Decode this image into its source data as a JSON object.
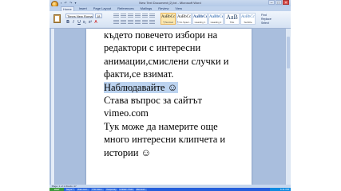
{
  "window": {
    "title": "New Text Document (2).txt - Microsoft Word",
    "quick_access": "▪ ↶ ↷ ▾",
    "controls": {
      "minimize": "–",
      "maximize": "□",
      "close": "×"
    }
  },
  "ribbon": {
    "tabs": [
      "Home",
      "Insert",
      "Page Layout",
      "References",
      "Mailings",
      "Review",
      "View"
    ],
    "active_tab": "Home",
    "font_name": "Times New Roman",
    "font_size": "18",
    "format_buttons": [
      "B",
      "I",
      "U",
      "x₂",
      "x²",
      "A"
    ],
    "styles": [
      {
        "sample": "AaBbCcDc",
        "name": "¶ Normal"
      },
      {
        "sample": "AaBbCcDc",
        "name": "¶ No Spaci..."
      },
      {
        "sample": "AaBbCc",
        "name": "Heading 1"
      },
      {
        "sample": "AaBbCc",
        "name": "Heading 2"
      },
      {
        "sample": "AaB",
        "name": "Title"
      },
      {
        "sample": "AaBbCc",
        "name": "Subtitle"
      }
    ],
    "editing": [
      "Find",
      "Replace",
      "Select"
    ]
  },
  "document": {
    "lines": [
      "където повечето избори на",
      "редактори с интересни",
      "анимации,смислени случки  и",
      "факти,се взимат.",
      "Наблюдавайте ☺",
      "Става въпрос за сайтът",
      "vimeo.com",
      "Тук може да намерите още",
      "много интересни клипчета и",
      "истории ☺"
    ],
    "highlighted_index": 4
  },
  "status": {
    "text": "Page: 1 of 1   Words: 47"
  },
  "taskbar": {
    "start": "start",
    "tasks": [
      "Skype™",
      "Video Aud...",
      "YTD Video...",
      "Kaspersky",
      "Untitled - Paint",
      "Microsoft..."
    ],
    "clock": "6:41 PM"
  }
}
